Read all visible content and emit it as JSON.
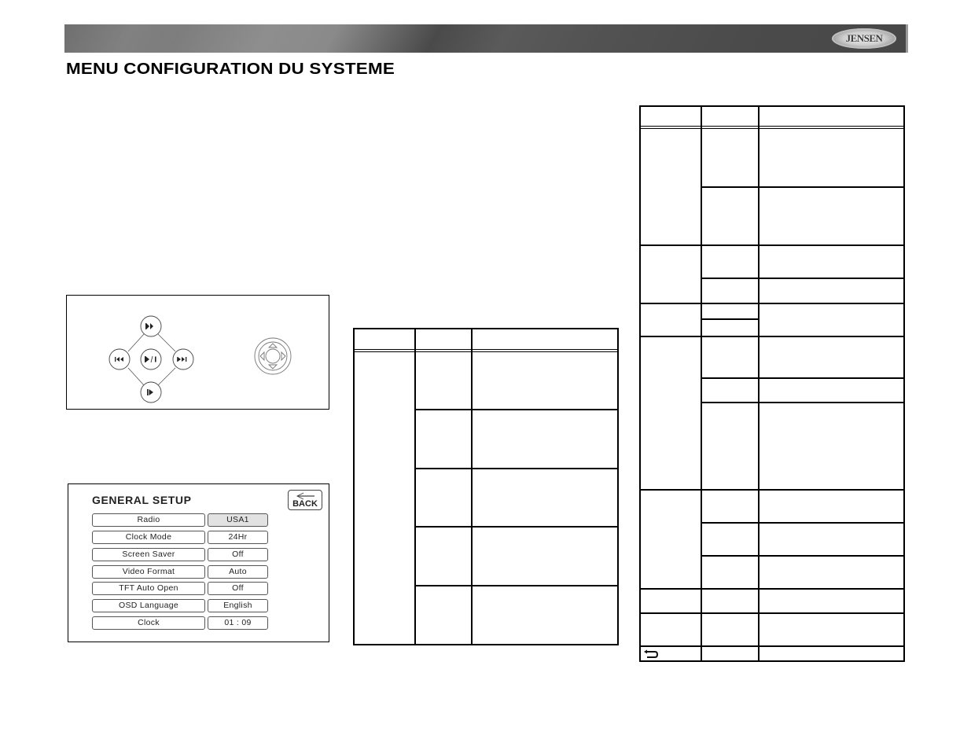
{
  "header": {
    "brand_logo_text": "JENSEN",
    "page_title": "MENU CONFIGURATION DU SYSTEME"
  },
  "remote_diagram": {
    "buttons": [
      {
        "name": "fast-forward",
        "icon": "fast-forward-icon",
        "glyph": "▶▶"
      },
      {
        "name": "previous-track",
        "icon": "skip-back-icon",
        "glyph": "⏮"
      },
      {
        "name": "play-pause",
        "icon": "play-pause-icon",
        "glyph": "▶/❚"
      },
      {
        "name": "next-track",
        "icon": "skip-forward-icon",
        "glyph": "⏭"
      },
      {
        "name": "slow-play",
        "icon": "step-play-icon",
        "glyph": "❚▶"
      }
    ],
    "joystick": {
      "icon": "directional-pad-icon"
    }
  },
  "general_setup": {
    "title": "GENERAL SETUP",
    "back_label": "BACK",
    "rows": [
      {
        "label": "Radio",
        "value": "USA1",
        "selected": true
      },
      {
        "label": "Clock  Mode",
        "value": "24Hr",
        "selected": false
      },
      {
        "label": "Screen Saver",
        "value": "Off",
        "selected": false
      },
      {
        "label": "Video Format",
        "value": "Auto",
        "selected": false
      },
      {
        "label": "TFT Auto Open",
        "value": "Off",
        "selected": false
      },
      {
        "label": "OSD Language",
        "value": "English",
        "selected": false
      },
      {
        "label": "Clock",
        "value": "01  :  09",
        "selected": false
      }
    ]
  },
  "middle_table": {
    "headers": [
      "",
      "",
      ""
    ],
    "rows": [
      [
        "",
        "",
        ""
      ],
      [
        "",
        "",
        ""
      ],
      [
        "",
        "",
        ""
      ],
      [
        "",
        "",
        ""
      ],
      [
        "",
        "",
        ""
      ]
    ]
  },
  "right_table": {
    "headers": [
      "",
      "",
      ""
    ],
    "last_row_icon": "return-icon"
  }
}
